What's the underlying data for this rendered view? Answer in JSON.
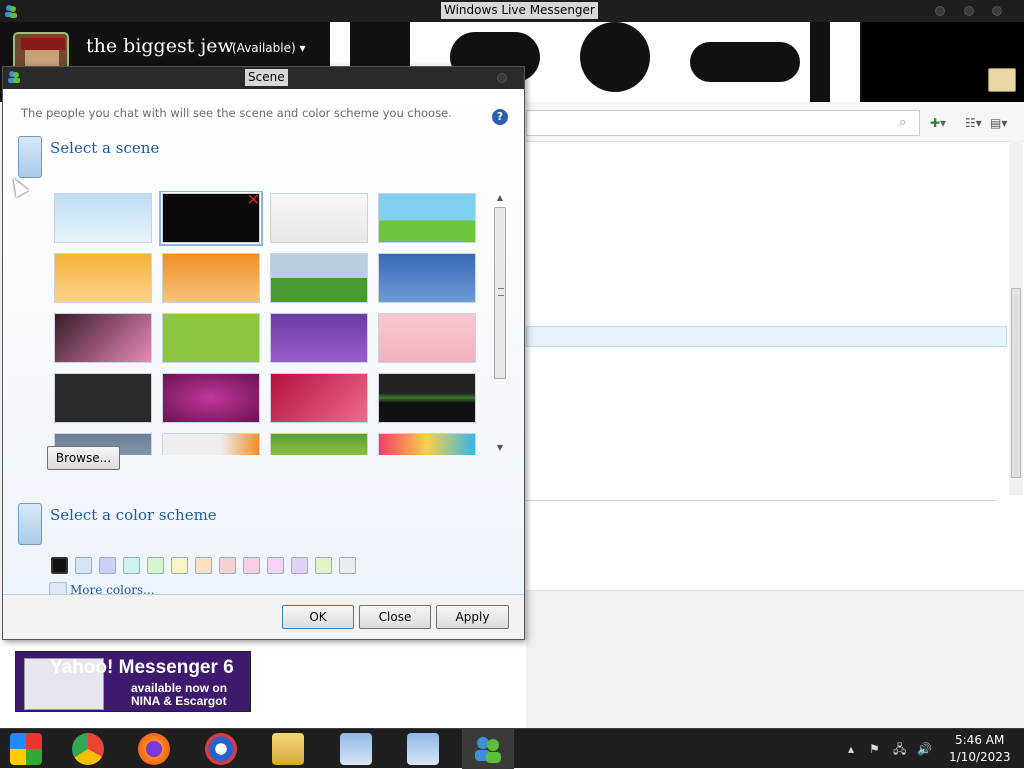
{
  "window": {
    "title": "Windows Live Messenger"
  },
  "profile": {
    "display_name": "the biggest jew",
    "status": "(Available)",
    "status_arrow": "▾"
  },
  "main": {
    "search_icon": "⌕",
    "add_contact_glyph": "✚▾",
    "layout_glyph": "☷▾",
    "options_glyph": "▤▾"
  },
  "ad": {
    "line1": "Yahoo! Messenger 6",
    "line2": "available now on",
    "line3": "NINA & Escargot"
  },
  "dialog": {
    "title": "Scene",
    "intro": "The people you chat with will see the scene and color scheme you choose.",
    "help_glyph": "?",
    "scene_heading": "Select a scene",
    "browse_label": "Browse...",
    "color_heading": "Select a color scheme",
    "more_colors_label": "More colors...",
    "ok_label": "OK",
    "close_label": "Close",
    "apply_label": "Apply",
    "delete_glyph": "✕",
    "scroll_up": "▲",
    "scroll_down": "▼",
    "scenes": [
      {
        "name": "light-blue-sky",
        "bg": "linear-gradient(#bcdcf2, #e9f4fb)"
      },
      {
        "name": "custom-black-white",
        "bg": "#0a0a0a",
        "selected": true
      },
      {
        "name": "white-bubbles",
        "bg": "linear-gradient(#f6f6f6, #e8e8e8)"
      },
      {
        "name": "green-field-sky",
        "bg": "linear-gradient(#7fd0ef 55%, #6cc53c 55%)"
      },
      {
        "name": "orange-tree",
        "bg": "linear-gradient(#f6b13a, #f8d38a)"
      },
      {
        "name": "orange-grass",
        "bg": "linear-gradient(#f08e27, #f6c37a)"
      },
      {
        "name": "green-hill-sky",
        "bg": "linear-gradient(#b7cfe0 50%, #4a9a34 50%)"
      },
      {
        "name": "blue-mountains",
        "bg": "linear-gradient(#3a68b5, #6f9bd6)"
      },
      {
        "name": "pink-pattern",
        "bg": "linear-gradient(135deg, #3a1a2a, #e58bb6)"
      },
      {
        "name": "lime-dots",
        "bg": "#8cc63f"
      },
      {
        "name": "purple-swirls",
        "bg": "linear-gradient(#6b3aa4, #9a5ec9)"
      },
      {
        "name": "pink-blossoms",
        "bg": "linear-gradient(#f7c9cf, #f1b2bd)"
      },
      {
        "name": "dark-lines",
        "bg": "#2a2a2a"
      },
      {
        "name": "magenta-burst",
        "bg": "radial-gradient(#c0379b, #6a1254)"
      },
      {
        "name": "red-pink-wave",
        "bg": "linear-gradient(135deg, #b3103f, #f06a8f)"
      },
      {
        "name": "dark-green-glow",
        "bg": "linear-gradient(#222 40%, #3a7a2a 50%, #111 60%)"
      },
      {
        "name": "gray-storm",
        "bg": "linear-gradient(#6a7d94, #9fb1c5)"
      },
      {
        "name": "white-orange",
        "bg": "linear-gradient(90deg, #eee 60%, #f08e27)"
      },
      {
        "name": "green-bamboo",
        "bg": "linear-gradient(#5aa12a, #c7e06b)"
      },
      {
        "name": "colorful-blobs",
        "bg": "linear-gradient(90deg, #f43d6a, #f9d04a, #35b6e8)"
      }
    ],
    "swatches": [
      {
        "name": "black",
        "color": "#111111",
        "selected": true
      },
      {
        "name": "light-blue",
        "color": "#d6e4f7"
      },
      {
        "name": "lavender",
        "color": "#cdd0f6"
      },
      {
        "name": "aqua",
        "color": "#cdf3f1"
      },
      {
        "name": "light-green",
        "color": "#d4f6cf"
      },
      {
        "name": "light-yellow",
        "color": "#f8f5c2"
      },
      {
        "name": "peach",
        "color": "#fbe0c3"
      },
      {
        "name": "salmon",
        "color": "#f8cfcf"
      },
      {
        "name": "pink",
        "color": "#f9cde3"
      },
      {
        "name": "light-pink",
        "color": "#f5d3f5"
      },
      {
        "name": "light-purple",
        "color": "#e0d1f5"
      },
      {
        "name": "lime",
        "color": "#e1f5c8"
      },
      {
        "name": "light-gray",
        "color": "#ececec"
      }
    ]
  },
  "taskbar": {
    "time": "5:46 AM",
    "date": "1/10/2023",
    "tray_up": "▴",
    "tray_flag": "⚑",
    "tray_network": "🖧",
    "tray_volume": "🔊"
  }
}
